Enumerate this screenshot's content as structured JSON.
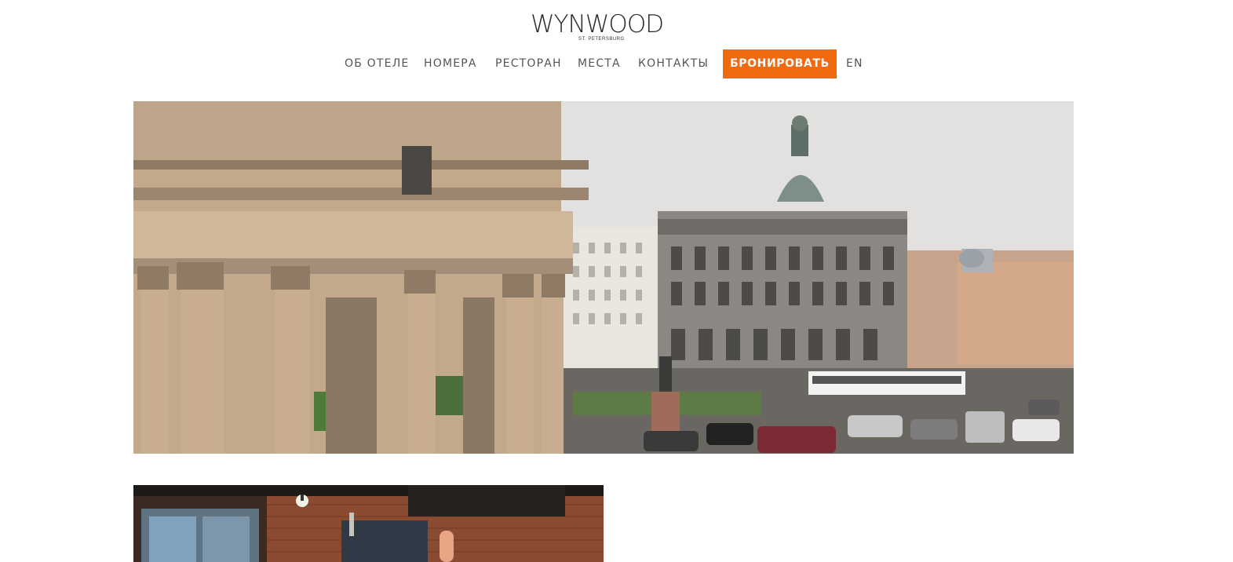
{
  "header": {
    "logo": {
      "main": "WYNWOOD",
      "sub": "ST. PETERSBURG"
    },
    "nav": [
      {
        "label": "ОБ ОТЕЛЕ"
      },
      {
        "label": "НОМЕРА"
      },
      {
        "label": "РЕСТОРАН"
      },
      {
        "label": "МЕСТА"
      },
      {
        "label": "КОНТАКТЫ"
      },
      {
        "label": "БРОНИРОВАТЬ"
      },
      {
        "label": "EN"
      }
    ]
  },
  "colors": {
    "accent": "#f26a0f",
    "nav_text": "#555555",
    "background": "#ffffff"
  },
  "hero": {
    "slides_count": 6,
    "active_slide": 1
  },
  "icons": {
    "logo": "wynwood-logo"
  }
}
